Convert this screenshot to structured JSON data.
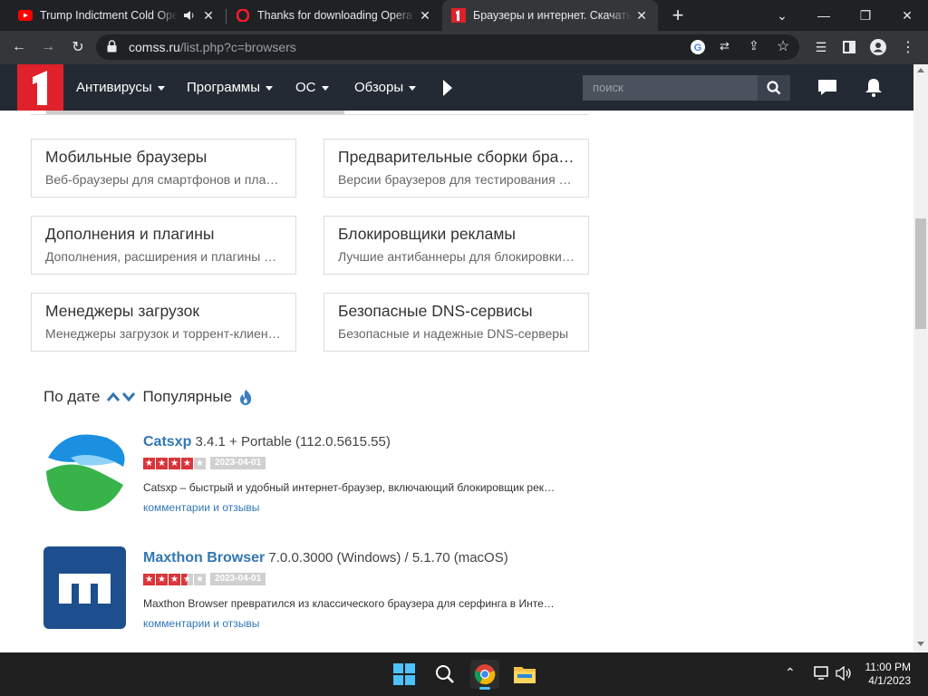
{
  "browser": {
    "tabs": [
      {
        "title": "Trump Indictment Cold Open - SNL"
      },
      {
        "title": "Thanks for downloading Opera"
      },
      {
        "title": "Браузеры и интернет. Скачать беспл"
      }
    ],
    "new_tab_label": "+",
    "url_host": "comss.ru",
    "url_path": "/list.php?c=browsers"
  },
  "site": {
    "nav": [
      "Антивирусы",
      "Программы",
      "ОС",
      "Обзоры"
    ],
    "search_placeholder": "поиск"
  },
  "categories": [
    {
      "title": "Мобильные браузеры",
      "desc": "Веб-браузеры для смартфонов и планшетов"
    },
    {
      "title": "Предварительные сборки браузеров",
      "desc": "Версии браузеров для тестирования новых функций"
    },
    {
      "title": "Дополнения и плагины",
      "desc": "Дополнения, расширения и плагины для браузеров"
    },
    {
      "title": "Блокировщики рекламы",
      "desc": "Лучшие антибаннеры для блокировки рекламы"
    },
    {
      "title": "Менеджеры загрузок",
      "desc": "Менеджеры загрузок и торрент-клиенты"
    },
    {
      "title": "Безопасные DNS-сервисы",
      "desc": "Безопасные и надежные DNS-серверы"
    }
  ],
  "sort": {
    "by_date": "По дате",
    "popular": "Популярные"
  },
  "items": [
    {
      "name": "Catsxp",
      "version": "3.4.1 + Portable (112.0.5615.55)",
      "rating": 4,
      "date": "2023-04-01",
      "desc": "Catsxp – быстрый и удобный интернет-браузер, включающий блокировщик рекламы",
      "link": "комментарии и отзывы"
    },
    {
      "name": "Maxthon Browser",
      "version": "7.0.0.3000 (Windows) / 5.1.70 (macOS)",
      "rating": 3.5,
      "date": "2023-04-01",
      "desc": "Maxthon Browser превратился из классического браузера для серфинга в Интернете",
      "link": "комментарии и отзывы"
    }
  ],
  "taskbar": {
    "time": "11:00 PM",
    "date": "4/1/2023"
  },
  "colors": {
    "accent": "#3277b3",
    "logo": "#e0202a",
    "nav_bg": "#232a34"
  }
}
